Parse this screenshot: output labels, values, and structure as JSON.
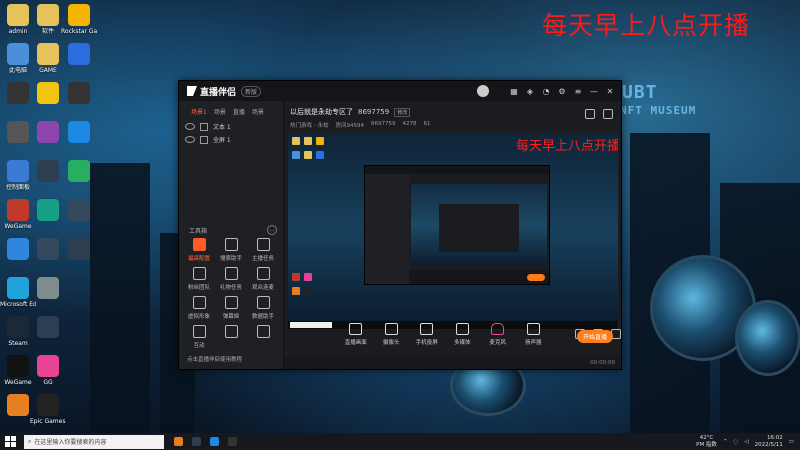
{
  "banner_text": "每天早上八点开播",
  "desktop": {
    "col1": [
      {
        "label": "admin",
        "icon": "user-folder-icon",
        "color": "#e6c25a"
      },
      {
        "label": "此电脑",
        "icon": "computer-icon",
        "color": "#4a90d9"
      },
      {
        "label": "",
        "icon": "app-icon",
        "color": "#333"
      },
      {
        "label": "",
        "icon": "app-icon",
        "color": "#555"
      },
      {
        "label": "控制面板",
        "icon": "control-panel-icon",
        "color": "#3a7bd5"
      },
      {
        "label": "WeGame",
        "icon": "wegame-icon",
        "color": "#c0392b"
      },
      {
        "label": "",
        "icon": "app-icon",
        "color": "#2e86de"
      },
      {
        "label": "Microsoft Edge",
        "icon": "edge-icon",
        "color": "#1fa3d8"
      },
      {
        "label": "Steam",
        "icon": "steam-icon",
        "color": "#1b2838"
      },
      {
        "label": "WeGame",
        "icon": "wegame-icon",
        "color": "#111"
      },
      {
        "label": "",
        "icon": "app-icon",
        "color": "#e67e22"
      }
    ],
    "col2": [
      {
        "label": "软件",
        "icon": "folder-icon",
        "color": "#e6c25a"
      },
      {
        "label": "GAME",
        "icon": "folder-icon",
        "color": "#e6c25a"
      },
      {
        "label": "",
        "icon": "app-icon",
        "color": "#f1c40f"
      },
      {
        "label": "",
        "icon": "app-icon",
        "color": "#8e44ad"
      },
      {
        "label": "",
        "icon": "app-icon",
        "color": "#2c3e50"
      },
      {
        "label": "",
        "icon": "app-icon",
        "color": "#16a085"
      },
      {
        "label": "",
        "icon": "app-icon",
        "color": "#34495e"
      },
      {
        "label": "",
        "icon": "app-icon",
        "color": "#7f8c8d"
      },
      {
        "label": "",
        "icon": "app-icon",
        "color": "#2c3e50"
      },
      {
        "label": "GG",
        "icon": "gg-icon",
        "color": "#e84393"
      },
      {
        "label": "Epic Games Launcher",
        "icon": "epic-icon",
        "color": "#222"
      }
    ],
    "col3": [
      {
        "label": "Rockstar Games",
        "icon": "rockstar-icon",
        "color": "#f4b400"
      },
      {
        "label": "",
        "icon": "app-icon",
        "color": "#2d6cdf"
      },
      {
        "label": "",
        "icon": "app-icon",
        "color": "#333"
      },
      {
        "label": "",
        "icon": "app-icon",
        "color": "#1e88e5"
      },
      {
        "label": "",
        "icon": "app-icon",
        "color": "#27ae60"
      },
      {
        "label": "",
        "icon": "app-icon",
        "color": "#34495e"
      },
      {
        "label": "",
        "icon": "app-icon",
        "color": "#2c3e50"
      }
    ]
  },
  "app": {
    "brand": "直播伴侣",
    "badge": "新版",
    "scene_tabs": [
      "场景1",
      "场景",
      "直播",
      "场景"
    ],
    "sources": [
      "文本 1",
      "全屏 1"
    ],
    "tools_title": "工具箱",
    "tools": [
      {
        "label": "福袋配置",
        "highlight": true
      },
      {
        "label": "搜索助手",
        "highlight": false
      },
      {
        "label": "主播任务",
        "highlight": false
      },
      {
        "label": "粉丝团队",
        "highlight": false
      },
      {
        "label": "礼物任务",
        "highlight": false
      },
      {
        "label": "观众连麦",
        "highlight": false
      },
      {
        "label": "虚拟形象",
        "highlight": false
      },
      {
        "label": "弹幕姬",
        "highlight": false
      },
      {
        "label": "数据助手",
        "highlight": false
      },
      {
        "label": "互动",
        "highlight": false
      },
      {
        "label": "",
        "highlight": false
      },
      {
        "label": "",
        "highlight": false
      }
    ],
    "side_footer": "点击直播伴侣使用教程",
    "room_title": "以后就是永劫专区了",
    "room_id": "8697759",
    "edit_label": "修改",
    "stats": [
      "热门游戏 - 永劫",
      "房间94594",
      "8697759",
      "4278",
      "61"
    ],
    "bottom_buttons": [
      {
        "label": "直播画面",
        "icon": "screen-icon"
      },
      {
        "label": "摄像头",
        "icon": "camera-icon"
      },
      {
        "label": "手机投屏",
        "icon": "phone-cast-icon"
      },
      {
        "label": "多媒体",
        "icon": "media-icon"
      },
      {
        "label": "麦克风",
        "icon": "mic-icon"
      },
      {
        "label": "扬声器",
        "icon": "speaker-icon"
      }
    ],
    "go_live": "开始直播",
    "status": "00:00:00"
  },
  "taskbar": {
    "search_placeholder": "在这里输入你要搜索的内容",
    "weather_temp": "42°C",
    "weather_desc": "PM 指数",
    "time": "16:02",
    "date": "2022/5/11"
  }
}
